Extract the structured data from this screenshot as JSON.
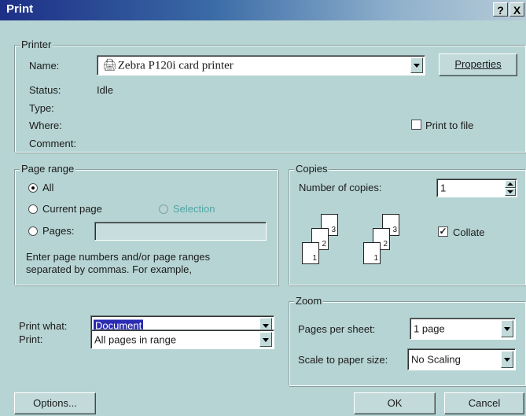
{
  "window": {
    "title": "Print",
    "help": "?",
    "close": "X"
  },
  "printer": {
    "group_label": "Printer",
    "name_label": "Name:",
    "name_value": "Zebra P120i card printer",
    "properties_label": "Properties",
    "status_label": "Status:",
    "status_value": "Idle",
    "type_label": "Type:",
    "where_label": "Where:",
    "comment_label": "Comment:",
    "print_to_file_label": "Print to file"
  },
  "page_range": {
    "group_label": "Page range",
    "all_label": "All",
    "current_label": "Current page",
    "selection_label": "Selection",
    "pages_label": "Pages:",
    "pages_value": "",
    "hint": "Enter page numbers and/or page ranges\nseparated by commas.  For example,"
  },
  "copies": {
    "group_label": "Copies",
    "number_label": "Number of copies:",
    "number_value": "1",
    "collate_label": "Collate",
    "collate_checked": true,
    "page_numbers": [
      "1",
      "2",
      "3"
    ]
  },
  "print_what": {
    "label": "Print what:",
    "value": "Document"
  },
  "print": {
    "label": "Print:",
    "value": "All pages in range"
  },
  "zoom": {
    "group_label": "Zoom",
    "pages_per_sheet_label": "Pages per sheet:",
    "pages_per_sheet_value": "1 page",
    "scale_label": "Scale to paper size:",
    "scale_value": "No Scaling"
  },
  "buttons": {
    "options": "Options...",
    "ok": "OK",
    "cancel": "Cancel"
  }
}
